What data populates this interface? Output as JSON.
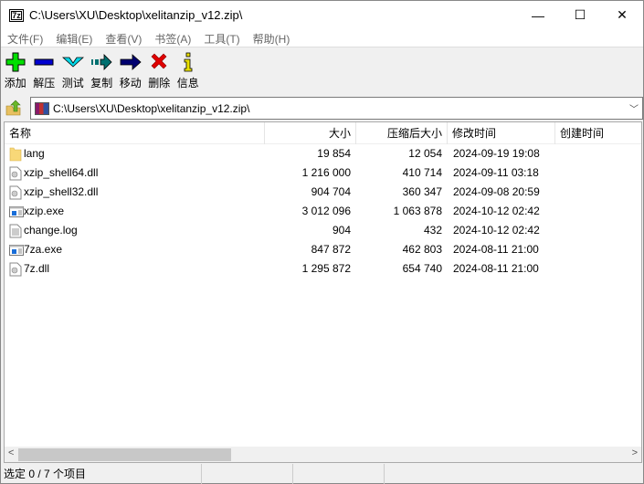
{
  "window": {
    "title": "C:\\Users\\XU\\Desktop\\xelitanzip_v12.zip\\",
    "app_icon": "7z",
    "minimize": "—",
    "maximize": "☐",
    "close": "✕"
  },
  "menu": [
    "文件(F)",
    "编辑(E)",
    "查看(V)",
    "书签(A)",
    "工具(T)",
    "帮助(H)"
  ],
  "toolbar": [
    {
      "label": "添加",
      "icon": "plus-icon",
      "color": "#00e000"
    },
    {
      "label": "解压",
      "icon": "minus-icon",
      "color": "#0000d0"
    },
    {
      "label": "测试",
      "icon": "check-icon",
      "color": "#00c8d8"
    },
    {
      "label": "复制",
      "icon": "copy-arrow-icon",
      "color": "#007070"
    },
    {
      "label": "移动",
      "icon": "move-arrow-icon",
      "color": "#000070"
    },
    {
      "label": "删除",
      "icon": "delete-x-icon",
      "color": "#e00000"
    },
    {
      "label": "信息",
      "icon": "info-icon",
      "color": "#e8e000"
    }
  ],
  "address": {
    "path": "C:\\Users\\XU\\Desktop\\xelitanzip_v12.zip\\"
  },
  "columns": [
    "名称",
    "大小",
    "压缩后大小",
    "修改时间",
    "创建时间"
  ],
  "files": [
    {
      "name": "lang",
      "size": "19 854",
      "packed": "12 054",
      "modified": "2024-09-19 19:08",
      "type": "folder"
    },
    {
      "name": "xzip_shell64.dll",
      "size": "1 216 000",
      "packed": "410 714",
      "modified": "2024-09-11 03:18",
      "type": "dll"
    },
    {
      "name": "xzip_shell32.dll",
      "size": "904 704",
      "packed": "360 347",
      "modified": "2024-09-08 20:59",
      "type": "dll"
    },
    {
      "name": "xzip.exe",
      "size": "3 012 096",
      "packed": "1 063 878",
      "modified": "2024-10-12 02:42",
      "type": "exe"
    },
    {
      "name": "change.log",
      "size": "904",
      "packed": "432",
      "modified": "2024-10-12 02:42",
      "type": "text"
    },
    {
      "name": "7za.exe",
      "size": "847 872",
      "packed": "462 803",
      "modified": "2024-08-11 21:00",
      "type": "exe"
    },
    {
      "name": "7z.dll",
      "size": "1 295 872",
      "packed": "654 740",
      "modified": "2024-08-11 21:00",
      "type": "dll"
    }
  ],
  "status": {
    "selection": "选定 0 / 7 个项目"
  }
}
